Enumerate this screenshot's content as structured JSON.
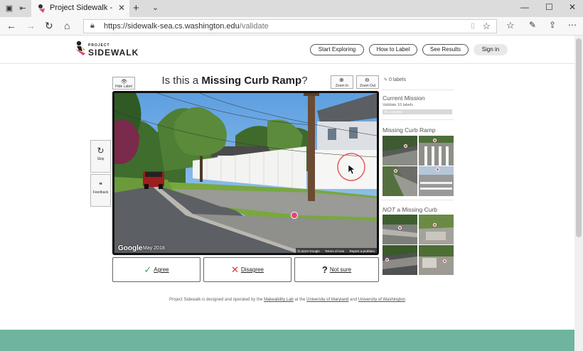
{
  "browser": {
    "tab_title": "Project Sidewalk - Valid",
    "url_host": "https://sidewalk-sea.cs.washington.edu",
    "url_path": "/validate"
  },
  "site": {
    "logo_small": "PROJECT",
    "logo_main": "SIDEWALK",
    "nav": {
      "start_exploring": "Start Exploring",
      "how_to_label": "How to Label",
      "see_results": "See Results",
      "sign_in": "Sign in"
    }
  },
  "task": {
    "hide_label": "Hide Label",
    "question_prefix": "Is this a ",
    "question_label": "Missing Curb Ramp",
    "question_suffix": "?",
    "zoom_in": "Zoom In",
    "zoom_out": "Zoom Out",
    "labels_count": "0 labels",
    "skip": "Skip",
    "feedback": "Feedback",
    "pano_logo": "Google",
    "pano_date": "May 2018",
    "pano_copyright": "© 2019 Google",
    "pano_terms": "Terms of Use",
    "pano_report": "Report a problem",
    "agree": "Agree",
    "disagree": "Disagree",
    "not_sure": "Not sure"
  },
  "mission": {
    "title": "Current Mission",
    "subtitle": "Validate 10 labels",
    "progress_text": "0% complete",
    "progress": 0.0
  },
  "examples": {
    "positive_title": "Missing Curb Ramp",
    "negative_prefix": "NOT",
    "negative_title": " a Missing Curb Ramp"
  },
  "footer": {
    "text1": "Project Sidewalk is designed and operated by the ",
    "link1": "Makeability Lab",
    "text2": " at the ",
    "link2": "University of Maryland",
    "text3": " and ",
    "link3": "University of Washington"
  },
  "colors": {
    "agree_check": "#3aa35a",
    "disagree_x": "#d9342b",
    "label_marker": "#e0457b",
    "footer_band": "#6fb49e"
  }
}
